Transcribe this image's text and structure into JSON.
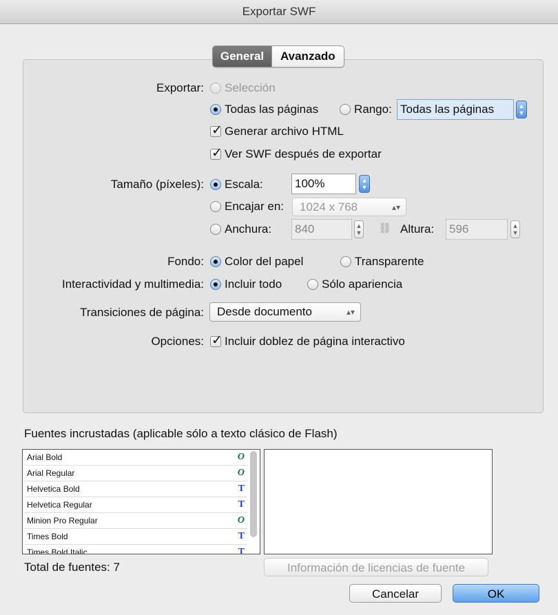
{
  "window": {
    "title": "Exportar SWF"
  },
  "tabs": [
    {
      "label": "General"
    },
    {
      "label": "Avanzado"
    }
  ],
  "exportar": {
    "label": "Exportar:",
    "seleccion": "Selección",
    "todas": "Todas las páginas",
    "rango": "Rango:",
    "rango_value": "Todas las páginas",
    "generar_html": "Generar archivo HTML",
    "ver_swf": "Ver SWF después de exportar"
  },
  "tamano": {
    "label": "Tamaño (píxeles):",
    "escala": "Escala:",
    "escala_value": "100%",
    "encajar": "Encajar en:",
    "encajar_value": "1024 x 768",
    "anchura": "Anchura:",
    "anchura_value": "840",
    "altura": "Altura:",
    "altura_value": "596"
  },
  "fondo": {
    "label": "Fondo:",
    "papel": "Color del papel",
    "transparente": "Transparente"
  },
  "interactividad": {
    "label": "Interactividad y multimedia:",
    "incluir": "Incluir todo",
    "solo": "Sólo apariencia"
  },
  "transiciones": {
    "label": "Transiciones de página:",
    "value": "Desde documento"
  },
  "opciones": {
    "label": "Opciones:",
    "doblez": "Incluir doblez de página interactivo"
  },
  "fuentes": {
    "heading": "Fuentes incrustadas (aplicable sólo a texto clásico de Flash)",
    "items": [
      {
        "name": "Arial Bold",
        "glyph": "O"
      },
      {
        "name": "Arial Regular",
        "glyph": "O"
      },
      {
        "name": "Helvetica Bold",
        "glyph": "T"
      },
      {
        "name": "Helvetica Regular",
        "glyph": "T"
      },
      {
        "name": "Minion Pro Regular",
        "glyph": "O"
      },
      {
        "name": "Times Bold",
        "glyph": "T"
      },
      {
        "name": "Times Bold Italic",
        "glyph": "T"
      }
    ],
    "total": "Total de fuentes: 7",
    "licencias": "Información de licencias de fuente"
  },
  "buttons": {
    "cancel": "Cancelar",
    "ok": "OK"
  },
  "icons": {
    "opentype": "opentype-font-icon",
    "truetype": "truetype-font-icon",
    "link": "chain-link-icon"
  }
}
